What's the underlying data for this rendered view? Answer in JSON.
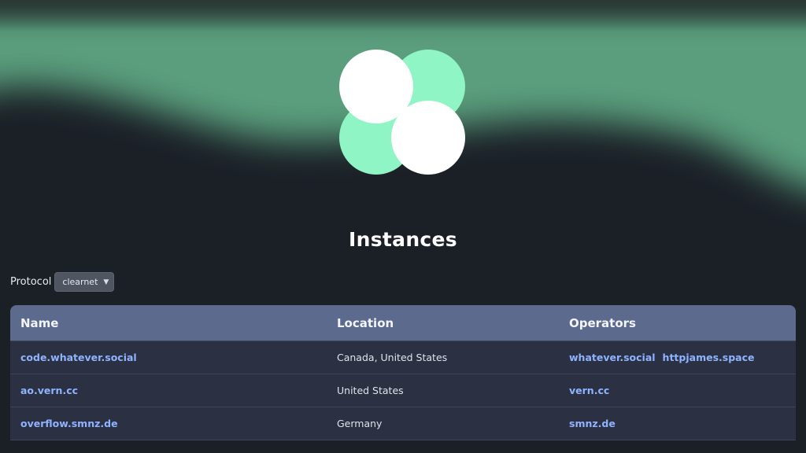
{
  "colors": {
    "background": "#1b2027",
    "wave": "#5a9e7d",
    "logo_white": "#ffffff",
    "logo_mint": "#8ff5c4",
    "table_header": "#5c6a8d",
    "table_row": "#2b3142",
    "link": "#8fb3ff"
  },
  "logo": {
    "icon": "four-circle-logo-icon"
  },
  "page": {
    "title": "Instances"
  },
  "protocol": {
    "label": "Protocol",
    "selected": "clearnet",
    "icon": "chevron-down-icon"
  },
  "table": {
    "headers": [
      "Name",
      "Location",
      "Operators"
    ],
    "rows": [
      {
        "name": "code.whatever.social",
        "location": "Canada, United States",
        "operators": [
          "whatever.social",
          "httpjames.space"
        ]
      },
      {
        "name": "ao.vern.cc",
        "location": "United States",
        "operators": [
          "vern.cc"
        ]
      },
      {
        "name": "overflow.smnz.de",
        "location": "Germany",
        "operators": [
          "smnz.de"
        ]
      }
    ]
  }
}
